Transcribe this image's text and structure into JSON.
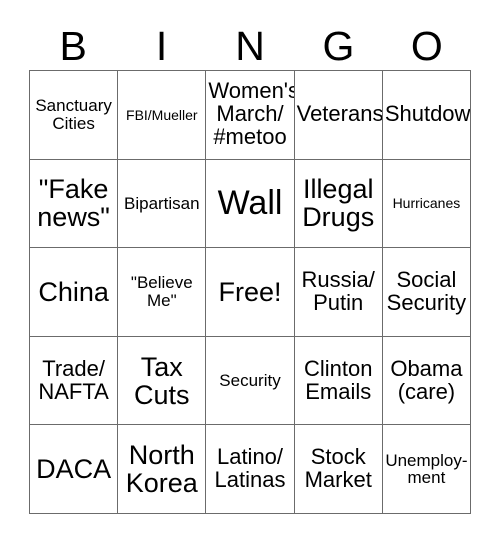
{
  "card": {
    "title_letters": [
      "B",
      "I",
      "N",
      "G",
      "O"
    ],
    "grid": {
      "rows": 5,
      "columns": 5,
      "border_color": "#6b6b6b",
      "background_color": "#ffffff",
      "text_color": "#000000"
    },
    "cells": [
      [
        {
          "text": "Sanctuary Cities",
          "size": "sm"
        },
        {
          "text": "FBI/Mueller",
          "size": "xs"
        },
        {
          "text": "Women's March/ #metoo",
          "size": "md"
        },
        {
          "text": "Veterans",
          "size": "md"
        },
        {
          "text": "Shutdown",
          "size": "md"
        }
      ],
      [
        {
          "text": "\"Fake news\"",
          "size": "lg"
        },
        {
          "text": "Bipartisan",
          "size": "sm"
        },
        {
          "text": "Wall",
          "size": "xl"
        },
        {
          "text": "Illegal Drugs",
          "size": "lg"
        },
        {
          "text": "Hurricanes",
          "size": "xs"
        }
      ],
      [
        {
          "text": "China",
          "size": "lg"
        },
        {
          "text": "\"Believe Me\"",
          "size": "sm"
        },
        {
          "text": "Free!",
          "size": "lg"
        },
        {
          "text": "Russia/ Putin",
          "size": "md"
        },
        {
          "text": "Social Security",
          "size": "md"
        }
      ],
      [
        {
          "text": "Trade/ NAFTA",
          "size": "md"
        },
        {
          "text": "Tax Cuts",
          "size": "lg"
        },
        {
          "text": "Security",
          "size": "sm"
        },
        {
          "text": "Clinton Emails",
          "size": "md"
        },
        {
          "text": "Obama (care)",
          "size": "md"
        }
      ],
      [
        {
          "text": "DACA",
          "size": "lg"
        },
        {
          "text": "North Korea",
          "size": "lg"
        },
        {
          "text": "Latino/ Latinas",
          "size": "md"
        },
        {
          "text": "Stock Market",
          "size": "md"
        },
        {
          "text": "Unemploy- ment",
          "size": "sm"
        }
      ]
    ]
  }
}
